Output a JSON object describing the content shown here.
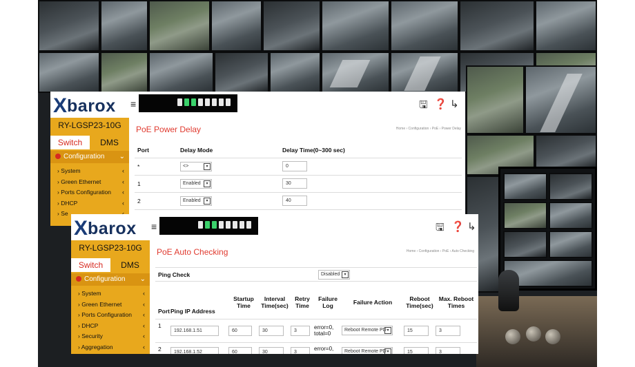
{
  "panel1": {
    "logo_x": "X",
    "logo_text": "barox",
    "menu_glyph": "≡",
    "model": "RY-LGSP23-10G",
    "tabs": [
      {
        "label": "Switch"
      },
      {
        "label": "DMS"
      }
    ],
    "section": "Configuration",
    "menu": [
      {
        "label": "System"
      },
      {
        "label": "Green Ethernet"
      },
      {
        "label": "Ports Configuration"
      },
      {
        "label": "DHCP"
      },
      {
        "label": "Se"
      }
    ],
    "title": "PoE Power Delay",
    "breadcrumb": "Home › Configuration › PoE › Power Delay",
    "columns": [
      "Port",
      "Delay Mode",
      "Delay Time(0~300 sec)"
    ],
    "rows": [
      {
        "port": "*",
        "mode": "<>",
        "time": "0"
      },
      {
        "port": "1",
        "mode": "Enabled",
        "time": "30"
      },
      {
        "port": "2",
        "mode": "Enabled",
        "time": "40"
      }
    ]
  },
  "panel2": {
    "logo_x": "X",
    "logo_text": "barox",
    "menu_glyph": "≡",
    "model": "RY-LGSP23-10G",
    "tabs": [
      {
        "label": "Switch"
      },
      {
        "label": "DMS"
      }
    ],
    "section": "Configuration",
    "menu": [
      {
        "label": "System"
      },
      {
        "label": "Green Ethernet"
      },
      {
        "label": "Ports Configuration"
      },
      {
        "label": "DHCP"
      },
      {
        "label": "Security"
      },
      {
        "label": "Aggregation"
      }
    ],
    "title": "PoE Auto Checking",
    "breadcrumb": "Home › Configuration › PoE › Auto Checking",
    "ping_check_label": "Ping Check",
    "ping_check_value": "Disabled",
    "columns": [
      "Port",
      "Ping IP Address",
      "Startup Time",
      "Interval Time(sec)",
      "Retry Time",
      "Failure Log",
      "Failure Action",
      "Reboot Time(sec)",
      "Max. Reboot Times"
    ],
    "rows": [
      {
        "port": "1",
        "ip": "192.168.1.51",
        "startup": "60",
        "interval": "30",
        "retry": "3",
        "log": "error=0, total=0",
        "action": "Reboot Remote PD",
        "reboot": "15",
        "max": "3"
      },
      {
        "port": "2",
        "ip": "192.168.1.52",
        "startup": "60",
        "interval": "30",
        "retry": "3",
        "log": "error=0,",
        "action": "Reboot Remote PD",
        "reboot": "15",
        "max": "3"
      }
    ]
  },
  "icons": {
    "save": "floppy-icon",
    "help": "help-icon",
    "logout": "logout-icon"
  },
  "colors": {
    "sidebar": "#e8a81d",
    "title": "#e03a2f",
    "brand": "#1a3c78"
  }
}
